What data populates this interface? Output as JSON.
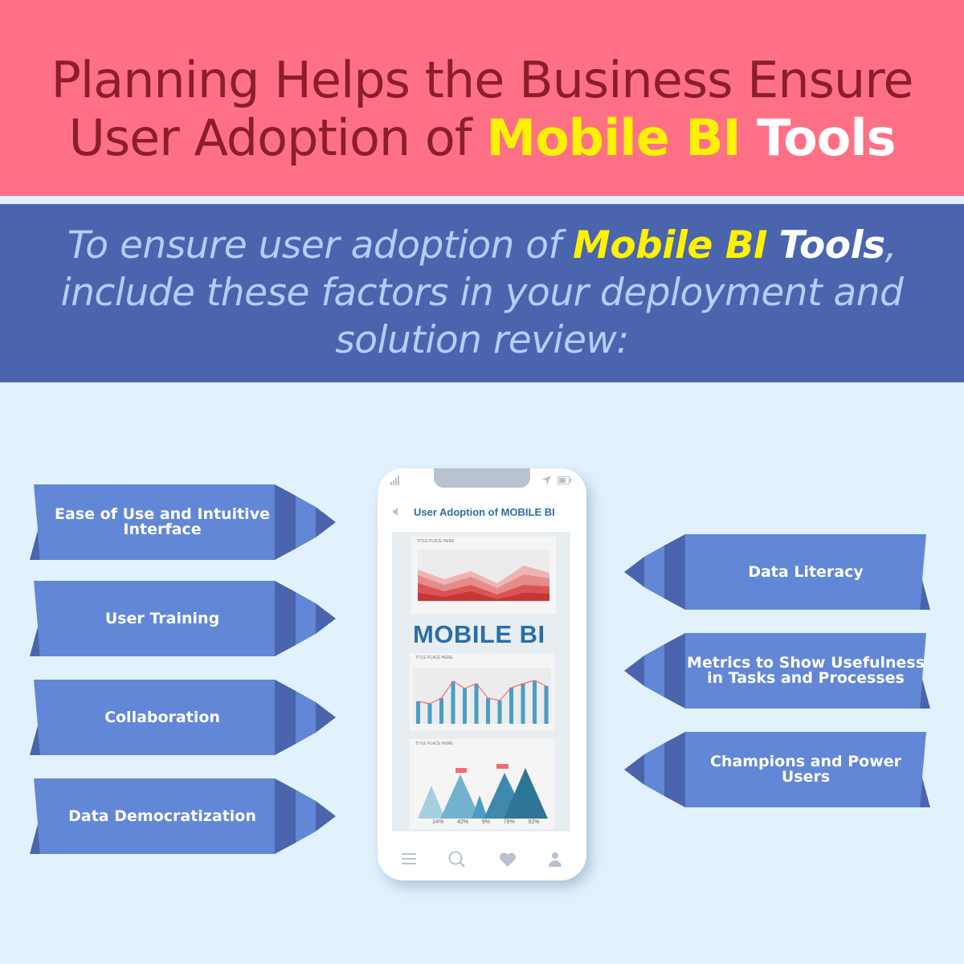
{
  "header": {
    "line1": "Planning Helps the Business Ensure",
    "line2_prefix": "User Adoption of ",
    "line2_highlight": "Mobile BI",
    "line2_suffix": " Tools"
  },
  "subheader": {
    "part1": "To ensure user adoption of ",
    "highlight": "Mobile BI",
    "white": "Tools",
    "part2": ", include these factors in your deployment and solution review:"
  },
  "left_factors": [
    "Ease of Use and Intuitive Interface",
    "User Training",
    "Collaboration",
    "Data Democratization"
  ],
  "right_factors": [
    "Data Literacy",
    "Metrics to Show Usefulness in Tasks and Processes",
    "Champions and Power Users"
  ],
  "phone": {
    "screen_title": "User Adoption of MOBILE BI",
    "big_label": "MOBILE BI",
    "chart_title": "TITLE PLACE HERE",
    "peak_values": [
      "24%",
      "42%",
      "9%",
      "79%",
      "92%"
    ],
    "nav_icons": [
      "menu-icon",
      "search-icon",
      "heart-icon",
      "user-icon"
    ]
  },
  "colors": {
    "top_band": "#fe7086",
    "title": "#8c1f24",
    "highlight": "#fff200",
    "blue_band": "#4a65ad",
    "arrow": "#6287d6",
    "arrow_dark": "#4a65ad",
    "background": "#e2f2fd"
  }
}
